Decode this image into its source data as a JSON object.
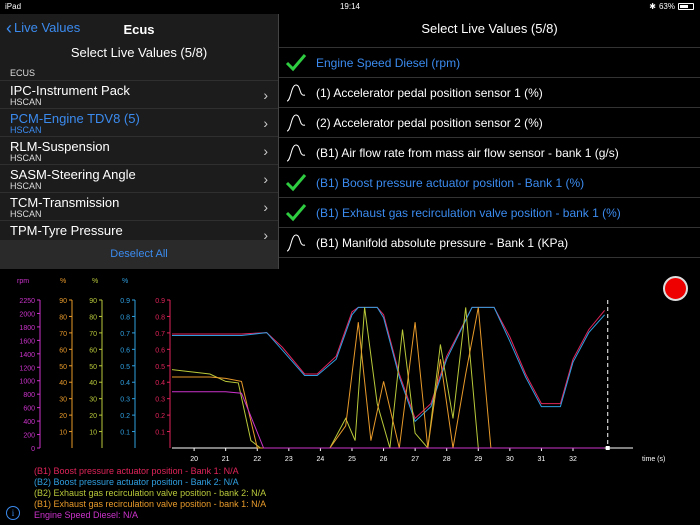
{
  "status": {
    "device": "iPad",
    "time": "19:14",
    "battery": "63%"
  },
  "left": {
    "back_label": "Live Values",
    "title": "Ecus",
    "subtitle": "Select Live Values (5/8)",
    "section": "ECUS",
    "ecus": [
      {
        "name": "IPC-Instrument Pack",
        "bus": "HSCAN",
        "selected": false
      },
      {
        "name": "PCM-Engine TDV8 (5)",
        "bus": "HSCAN",
        "selected": true
      },
      {
        "name": "RLM-Suspension",
        "bus": "HSCAN",
        "selected": false
      },
      {
        "name": "SASM-Steering Angle",
        "bus": "HSCAN",
        "selected": false
      },
      {
        "name": "TCM-Transmission",
        "bus": "HSCAN",
        "selected": false
      },
      {
        "name": "TPM-Tyre Pressure",
        "bus": "",
        "selected": false
      }
    ],
    "deselect_label": "Deselect All"
  },
  "right": {
    "title": "Select Live Values (5/8)",
    "items": [
      {
        "label": "Engine Speed Diesel (rpm)",
        "selected": true
      },
      {
        "label": "(1) Accelerator pedal position sensor 1 (%)",
        "selected": false
      },
      {
        "label": "(2) Accelerator pedal position sensor 2 (%)",
        "selected": false
      },
      {
        "label": "(B1) Air flow rate from mass air flow sensor - bank 1 (g/s)",
        "selected": false
      },
      {
        "label": "(B1) Boost pressure actuator position  -  Bank 1 (%)",
        "selected": true
      },
      {
        "label": "(B1) Exhaust gas recirculation valve position - bank 1 (%)",
        "selected": true
      },
      {
        "label": "(B1) Manifold absolute pressure  -  Bank 1 (KPa)",
        "selected": false
      }
    ]
  },
  "chart_data": {
    "type": "line",
    "xlabel": "time (s)",
    "x_ticks": [
      20,
      21,
      22,
      23,
      24,
      25,
      26,
      27,
      28,
      29,
      30,
      31,
      32
    ],
    "xlim": [
      19.3,
      33.9
    ],
    "cursor_x": 33.1,
    "axes": [
      {
        "unit": "rpm",
        "color": "#cc33cc",
        "ticks": [
          0,
          200,
          400,
          600,
          800,
          1000,
          1200,
          1400,
          1600,
          1800,
          2000,
          2250
        ]
      },
      {
        "unit": "%",
        "color": "#e89a2a",
        "ticks": [
          10,
          20,
          30,
          40,
          50,
          60,
          70,
          80,
          90
        ]
      },
      {
        "unit": "%",
        "color": "#b9c93a",
        "ticks": [
          10,
          20,
          30,
          40,
          50,
          60,
          70,
          80,
          90
        ]
      },
      {
        "unit": "%",
        "color": "#2f9fe0",
        "ticks": [
          0.1,
          0.2,
          0.3,
          0.4,
          0.5,
          0.6,
          0.7,
          0.8,
          0.9
        ]
      },
      {
        "unit": "",
        "color": "#e0245a",
        "ticks": [
          0.1,
          0.2,
          0.3,
          0.4,
          0.5,
          0.6,
          0.7,
          0.8,
          0.9
        ]
      }
    ],
    "series": [
      {
        "name": "(B1) Boost pressure actuator position  -  Bank 1",
        "color": "#e0245a",
        "x": [
          19.3,
          21.5,
          22.3,
          22.8,
          23.5,
          23.9,
          24.5,
          25.0,
          25.2,
          25.8,
          26.0,
          26.5,
          27.0,
          27.5,
          28.0,
          28.8,
          29.5,
          30.0,
          30.5,
          31.0,
          31.6,
          32.0,
          32.5,
          33.0
        ],
        "y": [
          0.77,
          0.77,
          0.78,
          0.68,
          0.5,
          0.5,
          0.62,
          0.92,
          0.95,
          0.95,
          0.9,
          0.5,
          0.2,
          0.3,
          0.62,
          0.95,
          0.95,
          0.75,
          0.5,
          0.3,
          0.3,
          0.6,
          0.8,
          0.93
        ]
      },
      {
        "name": "(B2) Boost pressure actuator position  -  Bank 2",
        "color": "#2f9fe0",
        "x": [
          19.3,
          21.5,
          22.3,
          22.8,
          23.5,
          23.9,
          24.5,
          25.0,
          25.2,
          25.8,
          26.0,
          26.5,
          27.0,
          27.5,
          28.0,
          28.8,
          29.5,
          30.0,
          30.5,
          31.0,
          31.6,
          32.0,
          32.5,
          33.0
        ],
        "y": [
          0.76,
          0.76,
          0.78,
          0.66,
          0.49,
          0.49,
          0.6,
          0.9,
          0.95,
          0.95,
          0.88,
          0.48,
          0.18,
          0.28,
          0.6,
          0.95,
          0.95,
          0.72,
          0.48,
          0.28,
          0.28,
          0.58,
          0.78,
          0.9
        ]
      },
      {
        "name": "(B2) Exhaust gas recirculation valve position - bank 2",
        "color": "#b9c93a",
        "x": [
          19.3,
          20.5,
          21.0,
          21.4,
          21.8,
          22.1,
          24.3,
          24.8,
          25.1,
          25.4,
          25.8,
          26.2,
          26.6,
          27.0,
          27.4,
          27.8,
          28.2,
          28.6,
          29.0,
          29.5,
          29.9,
          30.5,
          33.0
        ],
        "y": [
          53,
          50,
          45,
          44,
          5,
          0,
          0,
          20,
          5,
          95,
          30,
          0,
          80,
          10,
          0,
          70,
          20,
          95,
          0,
          0,
          0,
          0,
          0
        ]
      },
      {
        "name": "(B1) Exhaust gas recirculation valve position - bank 1",
        "color": "#e89a2a",
        "x": [
          19.3,
          20.5,
          21.0,
          21.5,
          22.0,
          24.3,
          24.8,
          25.2,
          25.6,
          26.0,
          26.5,
          27.0,
          27.4,
          27.8,
          28.2,
          28.6,
          29.0,
          29.4,
          30.0,
          33.0
        ],
        "y": [
          48,
          48,
          47,
          45,
          0,
          0,
          15,
          85,
          5,
          45,
          0,
          85,
          0,
          60,
          0,
          50,
          95,
          0,
          0,
          0
        ]
      },
      {
        "name": "Engine Speed Diesel",
        "color": "#cc33cc",
        "x": [
          19.3,
          21.0,
          21.5,
          22.2,
          22.5,
          33.0
        ],
        "y": [
          0.38,
          0.38,
          0.37,
          0.0,
          0.0,
          0.0
        ]
      }
    ],
    "legend": [
      {
        "label": "(B1) Boost pressure actuator position  -  Bank 1: N/A",
        "color": "#e0245a"
      },
      {
        "label": "(B2) Boost pressure actuator position  -  Bank 2: N/A",
        "color": "#2f9fe0"
      },
      {
        "label": "(B2) Exhaust gas recirculation valve position - bank 2: N/A",
        "color": "#b9c93a"
      },
      {
        "label": "(B1) Exhaust gas recirculation valve position - bank 1: N/A",
        "color": "#e89a2a"
      },
      {
        "label": "Engine Speed Diesel: N/A",
        "color": "#cc33cc"
      }
    ]
  },
  "colors": {
    "accent": "#3b8bef",
    "check": "#2ecc40",
    "record": "#ee0000"
  }
}
